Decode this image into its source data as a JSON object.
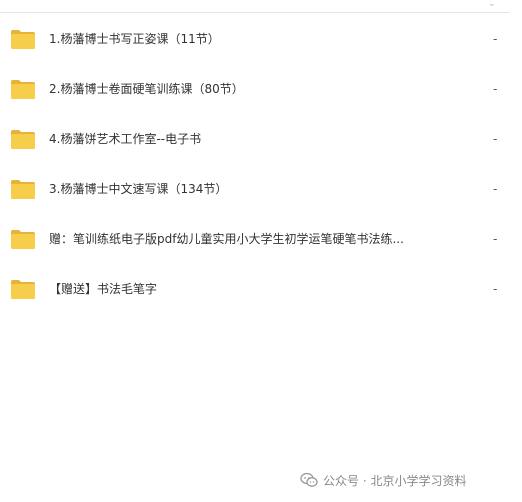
{
  "files": [
    {
      "name": "1.杨藩博士书写正姿课（11节）",
      "size": "-",
      "icon": "folder-icon"
    },
    {
      "name": "2.杨藩博士卷面硬笔训练课（80节）",
      "size": "-",
      "icon": "folder-icon"
    },
    {
      "name": "4.杨藩饼艺术工作室--电子书",
      "size": "-",
      "icon": "folder-icon"
    },
    {
      "name": "3.杨藩博士中文速写课（134节）",
      "size": "-",
      "icon": "folder-icon"
    },
    {
      "name": "赠：笔训练纸电子版pdf幼儿童实用小大学生初学运笔硬笔书法练...",
      "size": "-",
      "icon": "folder-icon"
    },
    {
      "name": "【赠送】书法毛笔字",
      "size": "-",
      "icon": "folder-icon"
    }
  ],
  "watermark": {
    "text": "公众号 · 北京小学学习资料",
    "icon": "wechat-icon"
  },
  "colors": {
    "folder_body": "#F7CE4C",
    "folder_tab": "#E8B23A",
    "text": "#333333",
    "watermark": "#888888"
  }
}
